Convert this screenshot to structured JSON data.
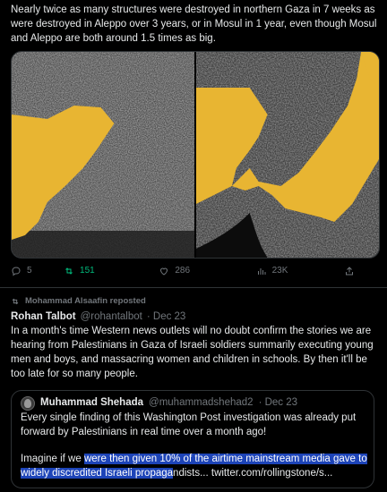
{
  "tweet1": {
    "text": "Nearly twice as many structures were destroyed in northern Gaza in 7 weeks as were destroyed in Aleppo over 3 years, or in Mosul in 1 year, even though Mosul and Aleppo are both around 1.5 times as big.",
    "replies": "5",
    "reposts": "151",
    "likes": "286",
    "views": "23K"
  },
  "tweet2": {
    "repost_line": "Mohammad Alsaafin reposted",
    "name": "Rohan Talbot",
    "handle": "@rohantalbot",
    "date": "· Dec 23",
    "text": "In a month's time Western news outlets will no doubt confirm the stories we are hearing from Palestinians in Gaza of Israeli soldiers summarily executing young men and boys, and massacring women and children in schools. By then it'll be too late for so many people.",
    "quote": {
      "name": "Muhammad Shehada",
      "handle": "@muhammadshehad2",
      "date": "· Dec 23",
      "line1": "Every single finding of this Washington Post investigation was already put forward by Palestinians in real time over a month ago!",
      "line2_pre": "Imagine if we ",
      "line2_hl1": "were then given 10% of the airtime mainstream media gave to",
      "line2_hl2": "widely discredited Israeli propaga",
      "line2_post": "ndists... twitter.com/rollingstone/s..."
    }
  },
  "colors": {
    "overlay": "#e8b532",
    "repost_green": "#00ba7c",
    "muted": "#71767b",
    "highlight": "#1d44b8"
  }
}
